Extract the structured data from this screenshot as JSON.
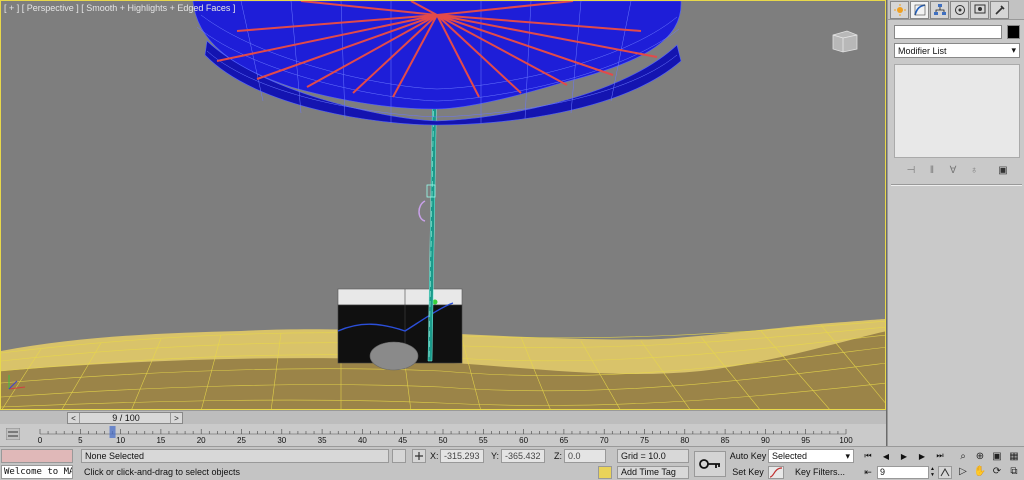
{
  "viewport": {
    "label": "[ + ] [ Perspective ] [ Smooth + Highlights + Edged Faces ]",
    "colors": {
      "background": "#7e7e7e",
      "umbrella": "#1f1fe0",
      "ribs": "#e24a4a",
      "pole": "#1a9a8a",
      "terrain_wire": "#e8d84a",
      "terrain_fill": "#8a7440",
      "cooler_lid": "#e8e8e8",
      "cooler_body": "#101010"
    }
  },
  "command_panel": {
    "tabs": [
      {
        "name": "create-icon"
      },
      {
        "name": "modify-icon"
      },
      {
        "name": "hierarchy-icon"
      },
      {
        "name": "motion-icon"
      },
      {
        "name": "display-icon"
      },
      {
        "name": "utilities-icon"
      }
    ],
    "object_name": "",
    "object_color": "#000000",
    "modifier_list": "Modifier List"
  },
  "timeline": {
    "slider_label": "9 / 100",
    "prev_glyph": "<",
    "next_glyph": ">",
    "ruler_labels": [
      "0",
      "5",
      "10",
      "15",
      "20",
      "25",
      "30",
      "35",
      "40",
      "45",
      "50",
      "55",
      "60",
      "65",
      "70",
      "75",
      "80",
      "85",
      "90",
      "95",
      "100"
    ]
  },
  "status": {
    "listener_output": "Welcome to MAXScript.",
    "selection": "None Selected",
    "prompt": "Click or click-and-drag to select objects",
    "x_label": "X:",
    "x_value": "-315.293",
    "y_label": "Y:",
    "y_value": "-365.432",
    "z_label": "Z:",
    "z_value": "0.0",
    "grid": "Grid = 10.0",
    "add_time_tag": "Add Time Tag",
    "auto_key": "Auto Key",
    "set_key": "Set Key",
    "selected_dropdown": "Selected",
    "key_filters": "Key Filters...",
    "current_frame": "9"
  },
  "playback": {
    "buttons": [
      "go-to-start",
      "previous-frame",
      "play",
      "next-frame",
      "go-to-end"
    ]
  }
}
